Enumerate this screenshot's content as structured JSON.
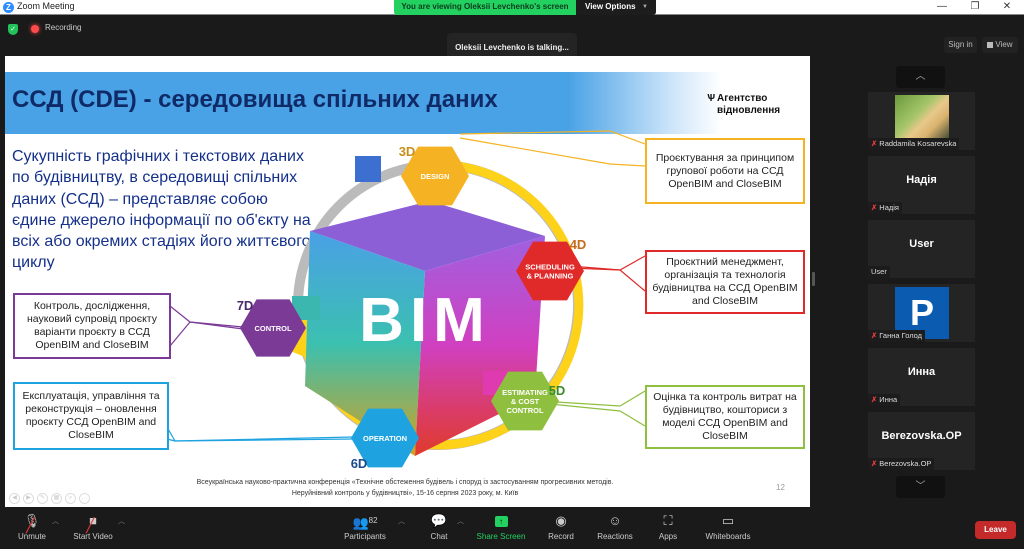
{
  "window": {
    "app_title": "Zoom Meeting",
    "banner": "You are viewing Oleksii Levchenko's screen",
    "view_options": "View Options",
    "minimize": "—",
    "maximize": "❐",
    "close": "✕"
  },
  "topbar": {
    "recording_label": "Recording",
    "talking": "Oleksii Levchenko is talking...",
    "sign_in": "Sign in",
    "view": "View"
  },
  "slide": {
    "title": "ССД (CDE) - середовища спільних даних",
    "agency_line1": "Агентство",
    "agency_line2": "відновлення",
    "intro": "Сукупність графічних і текстових даних по будівництву, в середовищі спільних даних (ССД) – представляє собою єдине джерело інформації по об'єкту на всіх або окремих стадіях його життєвого циклу",
    "bim_label": "BIM",
    "stages": [
      {
        "dim": "3D",
        "name": "DESIGN",
        "color": "#f5b324"
      },
      {
        "dim": "4D",
        "name": "SCHEDULING & PLANNING",
        "color": "#e02a2a"
      },
      {
        "dim": "5D",
        "name": "ESTIMATING & COST CONTROL",
        "color": "#8fbf3e"
      },
      {
        "dim": "6D",
        "name": "OPERATION",
        "color": "#1ea3e0"
      },
      {
        "dim": "7D",
        "name": "CONTROL",
        "color": "#7a3a96"
      }
    ],
    "callouts": {
      "design": "Проєктування за принципом групової роботи на ССД OpenBIM and CloseBIM",
      "planning": "Проєктний менеджмент, організація та технологія будівництва на ССД OpenBIM and CloseBIM",
      "cost": "Оцінка та контроль витрат на будівництво, кошториси з моделі ССД OpenBIM and CloseBIM",
      "operation": "Експлуатація, управління та реконструкція – оновлення проєкту ССД OpenBIM and CloseBIM",
      "control": "Контроль, дослідження, науковий супровід проєкту варіанти проєкту в ССД OpenBIM and CloseBIM"
    },
    "footer_line1": "Всеукраїнська науково-практична конференція «Технічне обстеження будівель і споруд із застосуванням прогресивних методів.",
    "footer_line2": "Неруйнівний контроль у будівництві», 15-16 серпня 2023 року, м. Київ",
    "page_number": "12"
  },
  "gallery": {
    "participants": [
      {
        "display": "",
        "tag": "Raddamila Kosarevska",
        "muted": true,
        "type": "photo"
      },
      {
        "display": "Надія",
        "tag": "Надія",
        "muted": true,
        "type": "name"
      },
      {
        "display": "User",
        "tag": "User",
        "muted": false,
        "type": "name"
      },
      {
        "display": "P",
        "tag": "Ганна Голод",
        "muted": true,
        "type": "avatar"
      },
      {
        "display": "Инна",
        "tag": "Инна",
        "muted": true,
        "type": "name"
      },
      {
        "display": "Berezovska.OP",
        "tag": "Berezovska.OP",
        "muted": true,
        "type": "name"
      }
    ]
  },
  "toolbar": {
    "unmute": "Unmute",
    "start_video": "Start Video",
    "participants": "Participants",
    "participant_count": "82",
    "chat": "Chat",
    "share_screen": "Share Screen",
    "record": "Record",
    "reactions": "Reactions",
    "apps": "Apps",
    "whiteboards": "Whiteboards",
    "leave": "Leave"
  }
}
